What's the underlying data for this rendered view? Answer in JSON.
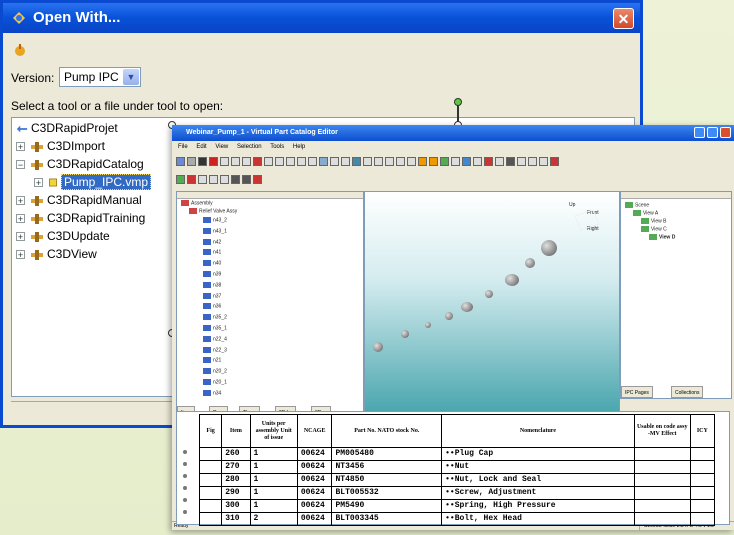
{
  "dialog": {
    "title": "Open With...",
    "version_label": "Version:",
    "version_value": "Pump IPC",
    "instruction": "Select a tool or a file under tool to open:",
    "close_label": "✕",
    "tree": {
      "root": "C3DRapidProjet",
      "items": [
        {
          "label": "C3DImport",
          "expand": "+"
        },
        {
          "label": "C3DRapidCatalog",
          "expand": "−"
        },
        {
          "label": "Pump_IPC.vmp",
          "expand": "+",
          "selected": true
        },
        {
          "label": "C3DRapidManual",
          "expand": "+"
        },
        {
          "label": "C3DRapidTraining",
          "expand": "+"
        },
        {
          "label": "C3DUpdate",
          "expand": "+"
        },
        {
          "label": "C3DView",
          "expand": "+"
        }
      ]
    }
  },
  "editor": {
    "title": "Webinar_Pump_1 - Virtual Part Catalog Editor",
    "menu": [
      "File",
      "Edit",
      "View",
      "Selection",
      "Tools",
      "Help"
    ],
    "assembly_tree": {
      "root": "Assembly",
      "sub": "Relief Valve Assy",
      "parts": [
        "n43_2",
        "n43_1",
        "n42",
        "n41",
        "n40",
        "n39",
        "n38",
        "n37",
        "n36",
        "n35_2",
        "n35_1",
        "n22_4",
        "n22_3",
        "n21",
        "n20_2",
        "n20_1",
        "n34"
      ]
    },
    "left_tabs": [
      "Ite...",
      "Re...",
      "Thu...",
      "2D I...",
      "3D ..."
    ],
    "scene_tree": {
      "root": "Scene",
      "items": [
        "View A",
        "View B",
        "View C",
        "View D"
      ]
    },
    "right_tabs": [
      "IPC Pages",
      "Collections"
    ],
    "viewport_axes": [
      "Up",
      "Front",
      "Right"
    ],
    "status_left": "Ready",
    "status_right": "S1000D Issue 2.3 IPD 4.0 v 1.2"
  },
  "parts_table": {
    "headers": [
      "Fig",
      "Item",
      "Units per assembly Unit of issue",
      "NCAGE",
      "Part No. NATO stock No.",
      "Nomenclature",
      "Usable on code assy -MV Effect",
      "ICY"
    ],
    "rows": [
      {
        "fig": "",
        "item": "260",
        "units": "1",
        "ncage": "00624",
        "part": "PM005480",
        "nom": "••Plug Cap",
        "usable": "",
        "icy": ""
      },
      {
        "fig": "",
        "item": "270",
        "units": "1",
        "ncage": "00624",
        "part": "NT3456",
        "nom": "••Nut",
        "usable": "",
        "icy": ""
      },
      {
        "fig": "",
        "item": "280",
        "units": "1",
        "ncage": "00624",
        "part": "NT4850",
        "nom": "••Nut, Lock and Seal",
        "usable": "",
        "icy": ""
      },
      {
        "fig": "",
        "item": "290",
        "units": "1",
        "ncage": "00624",
        "part": "BLT005532",
        "nom": "••Screw, Adjustment",
        "usable": "",
        "icy": ""
      },
      {
        "fig": "",
        "item": "300",
        "units": "1",
        "ncage": "00624",
        "part": "PM5490",
        "nom": "••Spring, High Pressure",
        "usable": "",
        "icy": ""
      },
      {
        "fig": "",
        "item": "310",
        "units": "2",
        "ncage": "00624",
        "part": "BLT003345",
        "nom": "••Bolt, Hex Head",
        "usable": "",
        "icy": ""
      }
    ]
  },
  "colors": {
    "titlebar": "#0751d8",
    "close": "#d2482a",
    "selection": "#316ac5",
    "handle_green": "#5ec93b"
  }
}
